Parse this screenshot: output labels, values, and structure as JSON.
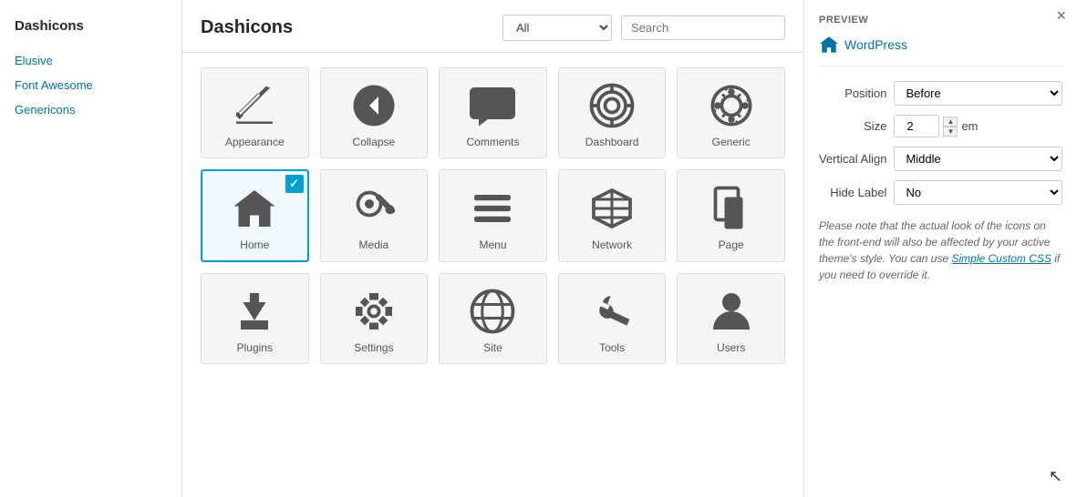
{
  "modal": {
    "title": "Dashicons",
    "close_label": "×"
  },
  "sidebar": {
    "title": "Dashicons",
    "items": [
      {
        "id": "elusive",
        "label": "Elusive"
      },
      {
        "id": "font-awesome",
        "label": "Font Awesome"
      },
      {
        "id": "genericons",
        "label": "Genericons"
      }
    ]
  },
  "toolbar": {
    "filter_value": "All",
    "search_placeholder": "Search",
    "filter_options": [
      "All"
    ]
  },
  "icons": [
    {
      "id": "appearance",
      "label": "Appearance",
      "selected": false
    },
    {
      "id": "collapse",
      "label": "Collapse",
      "selected": false
    },
    {
      "id": "comments",
      "label": "Comments",
      "selected": false
    },
    {
      "id": "dashboard",
      "label": "Dashboard",
      "selected": false
    },
    {
      "id": "generic",
      "label": "Generic",
      "selected": false
    },
    {
      "id": "home",
      "label": "Home",
      "selected": true
    },
    {
      "id": "media",
      "label": "Media",
      "selected": false
    },
    {
      "id": "menu",
      "label": "Menu",
      "selected": false
    },
    {
      "id": "network",
      "label": "Network",
      "selected": false
    },
    {
      "id": "page",
      "label": "Page",
      "selected": false
    },
    {
      "id": "plugins",
      "label": "Plugins",
      "selected": false
    },
    {
      "id": "settings",
      "label": "Settings",
      "selected": false
    },
    {
      "id": "site",
      "label": "Site",
      "selected": false
    },
    {
      "id": "tools",
      "label": "Tools",
      "selected": false
    },
    {
      "id": "users",
      "label": "Users",
      "selected": false
    }
  ],
  "preview": {
    "section_label": "PREVIEW",
    "preview_text": "WordPress",
    "position_label": "Position",
    "position_value": "Before",
    "size_label": "Size",
    "size_value": "2",
    "size_unit": "em",
    "valign_label": "Vertical Align",
    "valign_value": "Middle",
    "hide_label_label": "Hide Label",
    "hide_label_value": "No",
    "note": "Please note that the actual look of the icons on the front-end will also be affected by your active theme's style. You can use ",
    "note_link": "Simple Custom CSS",
    "note_suffix": " if you need to override it."
  }
}
